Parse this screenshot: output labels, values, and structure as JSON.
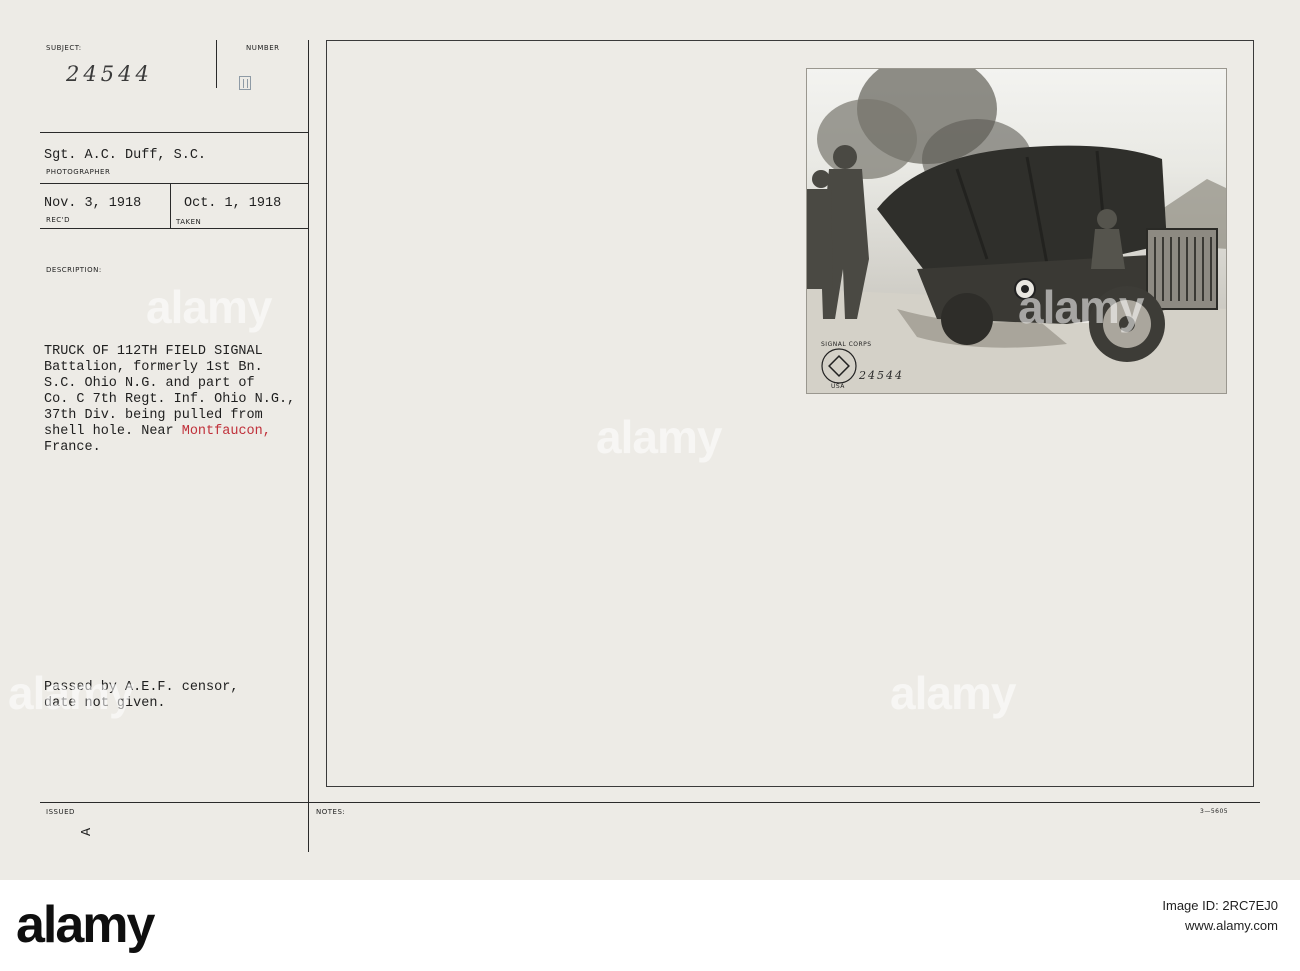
{
  "card": {
    "subject_label": "SUBJECT:",
    "number_label": "NUMBER",
    "subject_number": "24544",
    "photographer": "Sgt. A.C. Duff, S.C.",
    "photographer_label": "PHOTOGRAPHER",
    "received_date": "Nov. 3, 1918",
    "received_label": "REC'D",
    "taken_date": "Oct. 1, 1918",
    "taken_label": "TAKEN",
    "description_label": "DESCRIPTION:",
    "description_lines": [
      "TRUCK OF 112TH FIELD SIGNAL",
      "Battalion, formerly 1st Bn.",
      "S.C. Ohio N.G. and part of",
      "Co. C 7th Regt. Inf. Ohio N.G.,",
      "37th Div. being pulled from",
      "shell hole. Near "
    ],
    "location": "Montfaucon,",
    "description_end": "France.",
    "censor_lines": [
      "Passed by A.E.F. censor,",
      "date not given."
    ],
    "issued_label": "ISSUED",
    "issued_mark": "A",
    "notes_label": "NOTES:",
    "form_code": "3—5605"
  },
  "photo": {
    "stamp_text": "SIGNAL CORPS",
    "stamp_country": "USA",
    "photo_number": "24544"
  },
  "watermark": {
    "text": "alamy"
  },
  "footer": {
    "logo": "alamy",
    "image_id_label": "Image ID: 2RC7EJ0",
    "url": "www.alamy.com"
  }
}
